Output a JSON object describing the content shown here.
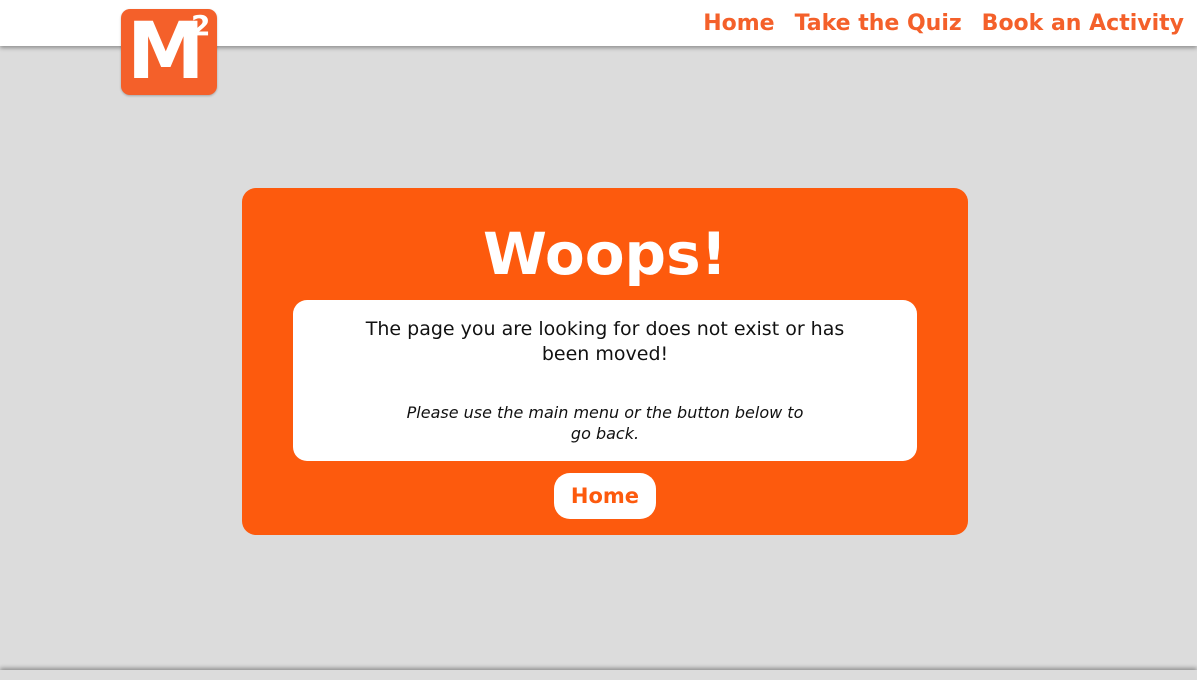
{
  "logo": {
    "letter": "M",
    "superscript": "2",
    "color": "#f4602a"
  },
  "nav": {
    "items": [
      {
        "label": "Home"
      },
      {
        "label": "Take the Quiz"
      },
      {
        "label": "Book an Activity"
      }
    ]
  },
  "error_card": {
    "title": "Woops!",
    "message": "The page you are looking for does not exist or has been moved!",
    "hint": "Please use the main menu or the button below to go back.",
    "button_label": "Home",
    "color": "#fd5a0d"
  },
  "colors": {
    "page_background": "#dcdcdc",
    "accent": "#f4602a",
    "card": "#fd5a0d"
  }
}
